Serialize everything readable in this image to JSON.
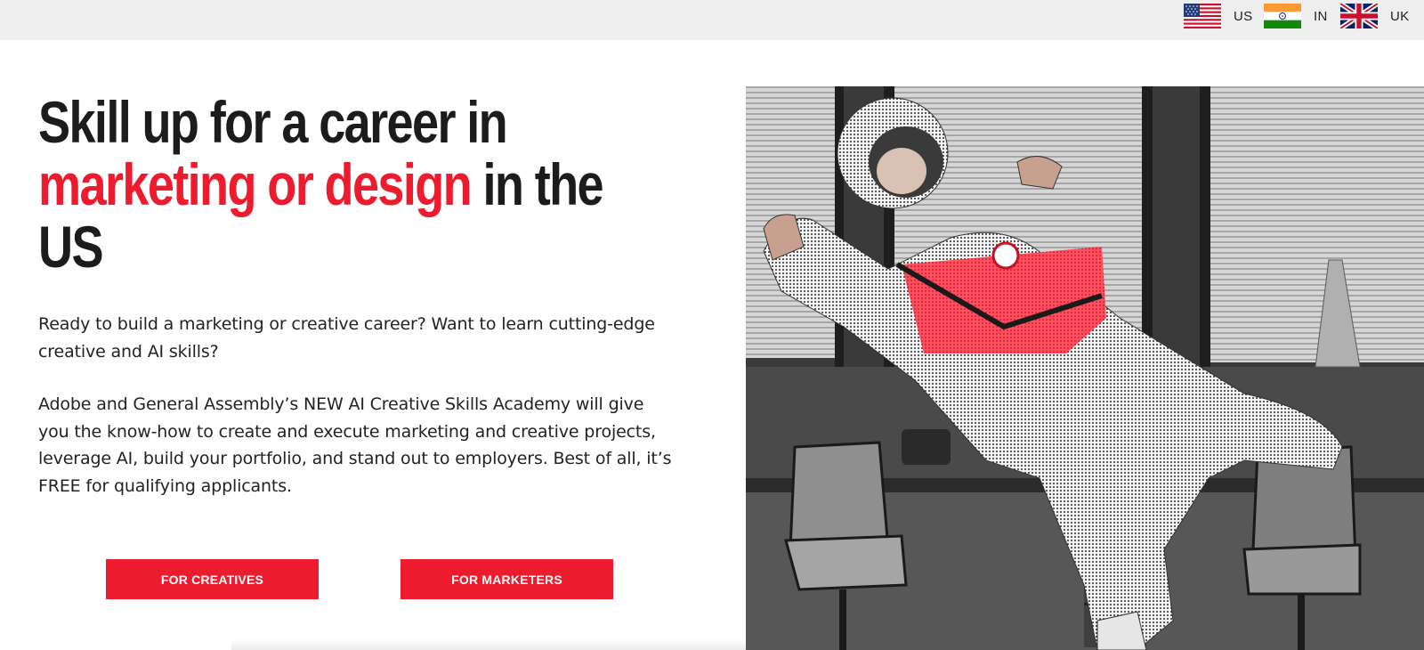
{
  "regions": [
    {
      "code": "US",
      "flag": "us-flag-icon"
    },
    {
      "code": "IN",
      "flag": "india-flag-icon"
    },
    {
      "code": "UK",
      "flag": "uk-flag-icon"
    }
  ],
  "hero": {
    "title_line1": "Skill up for a career in",
    "title_accent": "marketing or design",
    "title_rest": "in the",
    "title_line3": "US",
    "paragraph1": "Ready to build a marketing or creative career? Want to learn cutting-edge creative and AI skills?",
    "paragraph2": "Adobe and General Assembly’s NEW AI Creative Skills Academy will give you the know-how to create and execute marketing and creative projects, leverage AI, build your portfolio, and stand out to employers. Best of all, it’s FREE for qualifying applicants."
  },
  "buttons": {
    "creatives": "FOR CREATIVES",
    "marketers": "FOR MARKETERS"
  },
  "colors": {
    "accent": "#ec1b2e",
    "topbar": "#eeeeee",
    "text": "#1c1c1c"
  },
  "image": {
    "subject": "astronaut-floating-in-office-photo"
  }
}
